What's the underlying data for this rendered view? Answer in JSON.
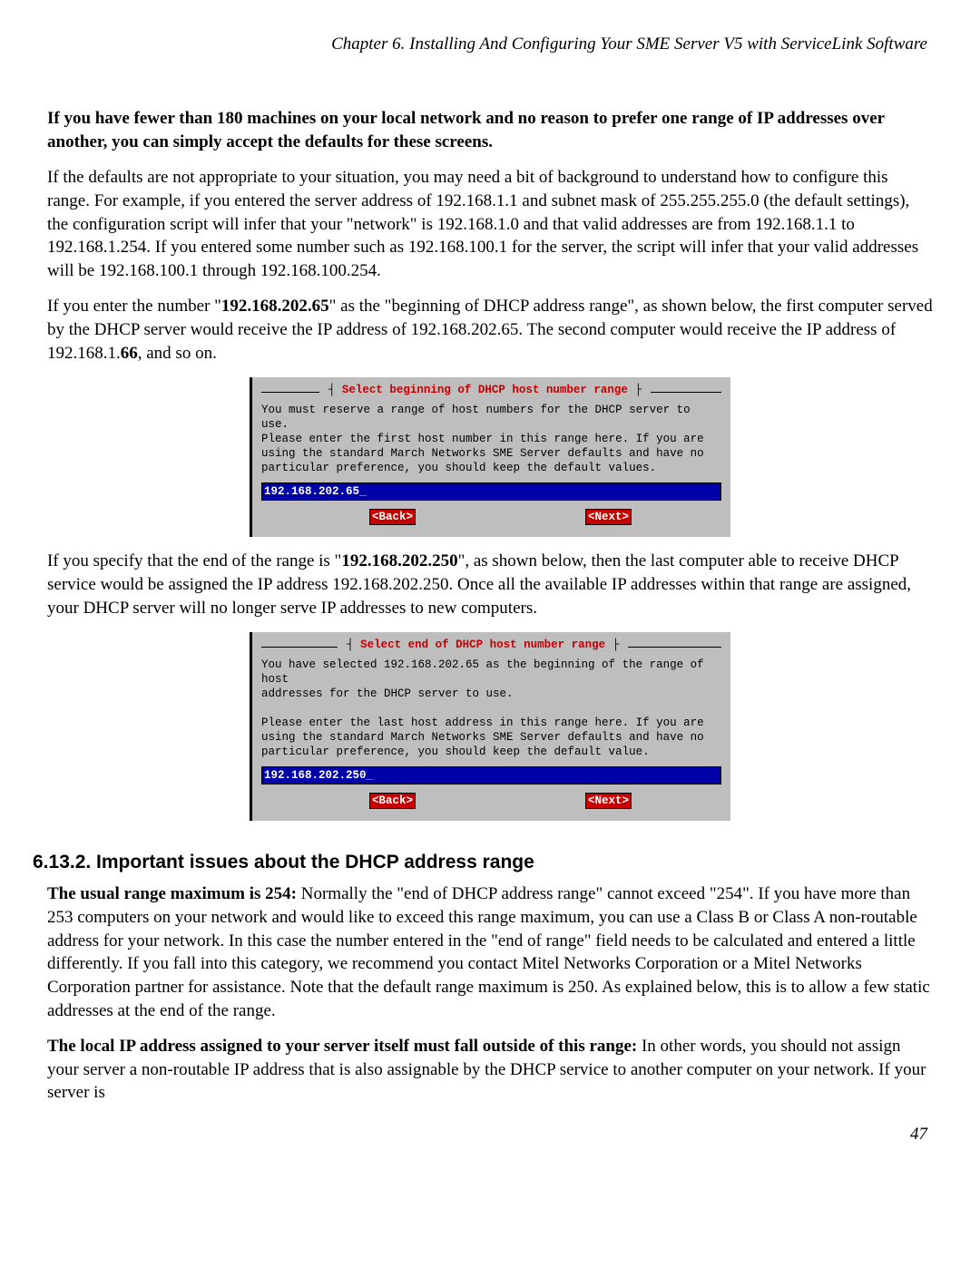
{
  "running_head": "Chapter 6. Installing And Configuring Your SME Server V5 with ServiceLink Software",
  "intro": {
    "bold": "If you have fewer than 180 machines on your local network and no reason to prefer one range of IP addresses over another, you can simply accept the defaults for these screens.",
    "p2": "If the defaults are not appropriate to your situation, you may need a bit of background to understand how to configure this range. For example, if you entered the server address of 192.168.1.1 and subnet mask of 255.255.255.0 (the default settings), the configuration script will infer that your \"network\" is 192.168.1.0 and that valid addresses are from 192.168.1.1 to 192.168.1.254. If you entered some number such as 192.168.100.1 for the server, the script will infer that your valid addresses will be 192.168.100.1 through 192.168.100.254.",
    "p3_pre": "If you enter the number \"",
    "p3_ip": "192.168.202.65",
    "p3_mid": "\" as the \"beginning of DHCP address range\", as shown below, the first computer served by the DHCP server would receive the IP address of 192.168.202.65. The second computer would receive the IP address of 192.168.1.",
    "p3_bold66": "66",
    "p3_post": ", and so on."
  },
  "tui1": {
    "title": "Select beginning of DHCP host number range",
    "body": "You must reserve a range of host numbers for the DHCP server to use.\nPlease enter the first host number in this range here. If you are\nusing the standard March Networks SME Server defaults and have no\nparticular preference, you should keep the default values.",
    "input": "192.168.202.65",
    "back": "<Back>",
    "next": "<Next>"
  },
  "mid": {
    "p1_pre": "If you specify that the end of the range is \"",
    "p1_ip": "192.168.202.250",
    "p1_post": "\", as shown below, then the last computer able to receive DHCP service would be assigned the IP address 192.168.202.250. Once all the available IP addresses within that range are assigned, your DHCP server will no longer serve IP addresses to new computers."
  },
  "tui2": {
    "title": "Select end of DHCP host number range",
    "body": "You have selected 192.168.202.65 as the beginning of the range of host\naddresses for the DHCP server to use.\n\nPlease enter the last host address in this range here. If you are\nusing the standard March Networks SME Server defaults and have no\nparticular preference, you should keep the default value.",
    "input": "192.168.202.250",
    "back": "<Back>",
    "next": "<Next>"
  },
  "section": {
    "heading": "6.13.2. Important issues about the DHCP address range",
    "p1_b": "The usual range maximum is 254:",
    "p1_rest": " Normally the \"end of DHCP address range\" cannot exceed \"254\". If you have more than 253 computers on your network and would like to exceed this range maximum, you can use a Class B or Class A non-routable address for your network. In this case the number entered in the \"end of range\" field needs to be calculated and entered a little differently. If you fall into this category, we recommend you contact Mitel Networks Corporation or a Mitel Networks Corporation partner for assistance. Note that the default range maximum is 250. As explained below, this is to allow a few static addresses at the end of the range.",
    "p2_b": "The local IP address assigned to your server itself must fall outside of this range:",
    "p2_rest": " In other words, you should not assign your server a non-routable IP address that is also assignable by the DHCP service to another computer on your network. If your server is"
  },
  "page_number": "47"
}
